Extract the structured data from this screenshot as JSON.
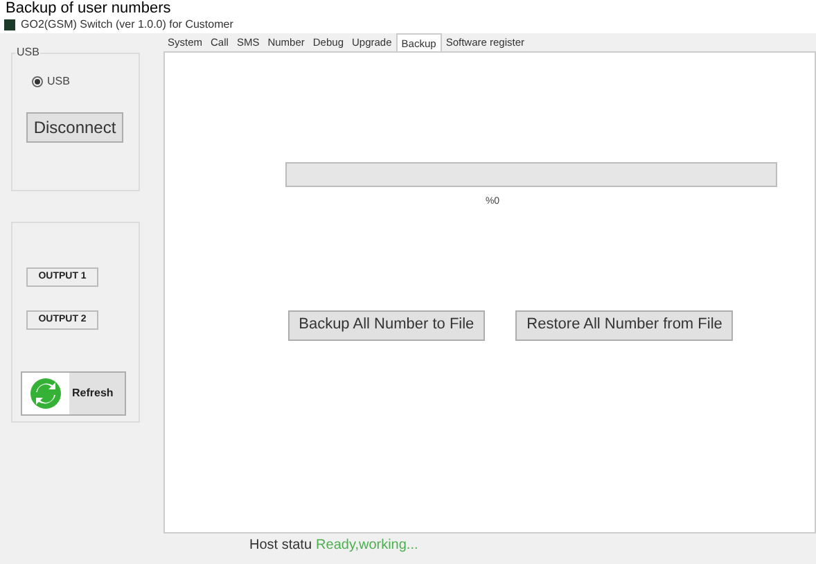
{
  "caption": "Backup of user numbers",
  "window": {
    "title": "GO2(GSM) Switch (ver 1.0.0) for Customer"
  },
  "sidebar": {
    "usb_group": {
      "label": "USB",
      "radios": [
        {
          "label": "USB",
          "selected": true
        }
      ],
      "button": "Disconnect"
    },
    "outputs": [
      "OUTPUT 1",
      "OUTPUT 2"
    ],
    "refresh_button": "Refresh"
  },
  "tabs": [
    {
      "label": "System",
      "selected": false
    },
    {
      "label": "Call",
      "selected": false
    },
    {
      "label": "SMS",
      "selected": false
    },
    {
      "label": "Number",
      "selected": false
    },
    {
      "label": "Debug",
      "selected": false
    },
    {
      "label": "Upgrade",
      "selected": false
    },
    {
      "label": "Backup",
      "selected": true
    },
    {
      "label": "Software register",
      "selected": false
    }
  ],
  "progress": {
    "level": 0,
    "reading": "%0"
  },
  "buttons": [
    "Backup All Number to File",
    "Restore All Number from File"
  ],
  "status_bar": {
    "label": "Host statu",
    "value": "Ready,working..."
  }
}
